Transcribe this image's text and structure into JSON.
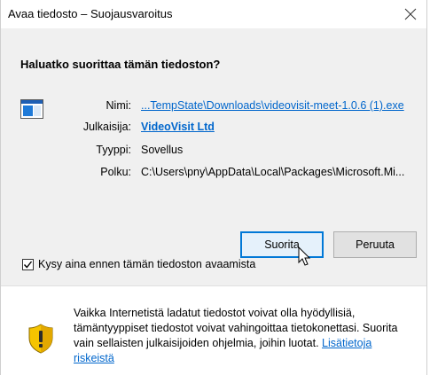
{
  "window": {
    "title": "Avaa tiedosto – Suojausvaroitus"
  },
  "question": "Haluatko suorittaa tämän tiedoston?",
  "file_icon": "executable-app-icon",
  "info": {
    "name_label": "Nimi:",
    "name_value": "...TempState\\Downloads\\videovisit-meet-1.0.6 (1).exe",
    "publisher_label": "Julkaisija:",
    "publisher_value": "VideoVisit Ltd",
    "type_label": "Tyyppi:",
    "type_value": "Sovellus",
    "path_label": "Polku:",
    "path_value": "C:\\Users\\pny\\AppData\\Local\\Packages\\Microsoft.Mi..."
  },
  "buttons": {
    "run": "Suorita",
    "cancel": "Peruuta"
  },
  "checkbox": {
    "label": "Kysy aina ennen tämän tiedoston avaamista",
    "checked": true
  },
  "warning": {
    "text": "Vaikka Internetistä ladatut tiedostot voivat olla hyödyllisiä, tämäntyyppiset tiedostot voivat vahingoittaa tietokonettasi. Suorita vain sellaisten julkaisijoiden ohjelmia, joihin luotat. ",
    "link": "Lisätietoja riskeistä"
  },
  "colors": {
    "link": "#0066cc",
    "default_button_border": "#0078d7",
    "content_bg": "#f0f0f0",
    "shield": "#f5c400"
  }
}
